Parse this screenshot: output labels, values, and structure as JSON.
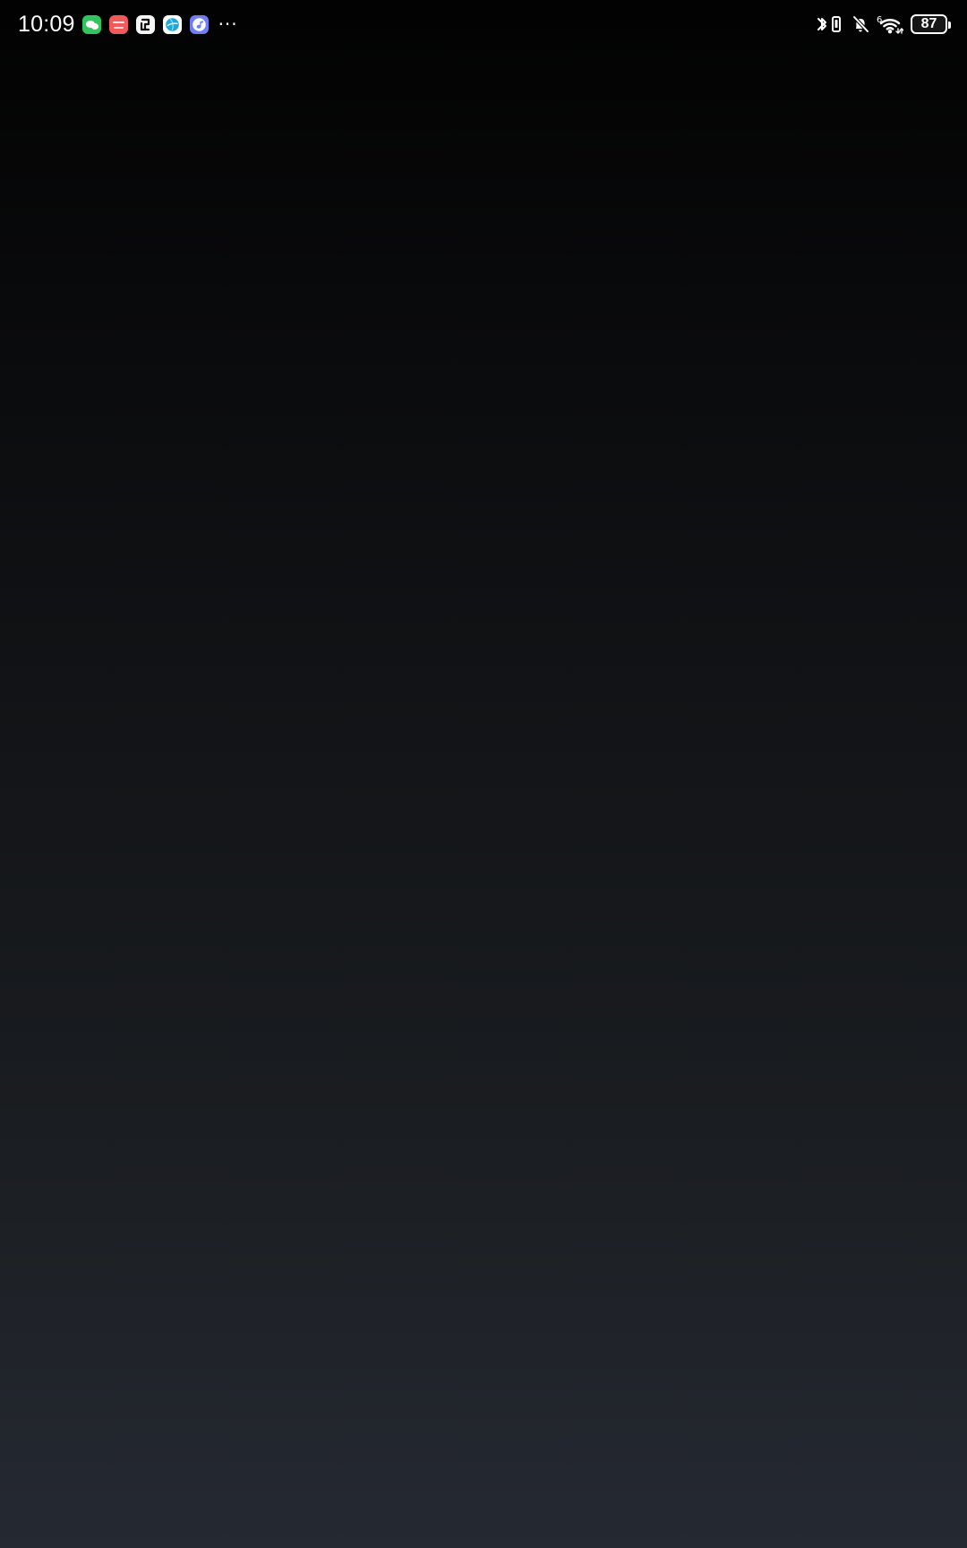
{
  "status_bar": {
    "time": "10:09",
    "notification_icons": [
      "wechat-icon",
      "shopping-app-icon",
      "link-app-icon",
      "browser-icon",
      "music-icon"
    ],
    "overflow": "···",
    "signal_label": "6",
    "battery_level": "87"
  },
  "colors": {
    "wechat": "#32c55f",
    "shopping": "#f05a5a",
    "music": "#6f7cf2",
    "background_top": "#020202",
    "background_bottom": "#252932"
  }
}
